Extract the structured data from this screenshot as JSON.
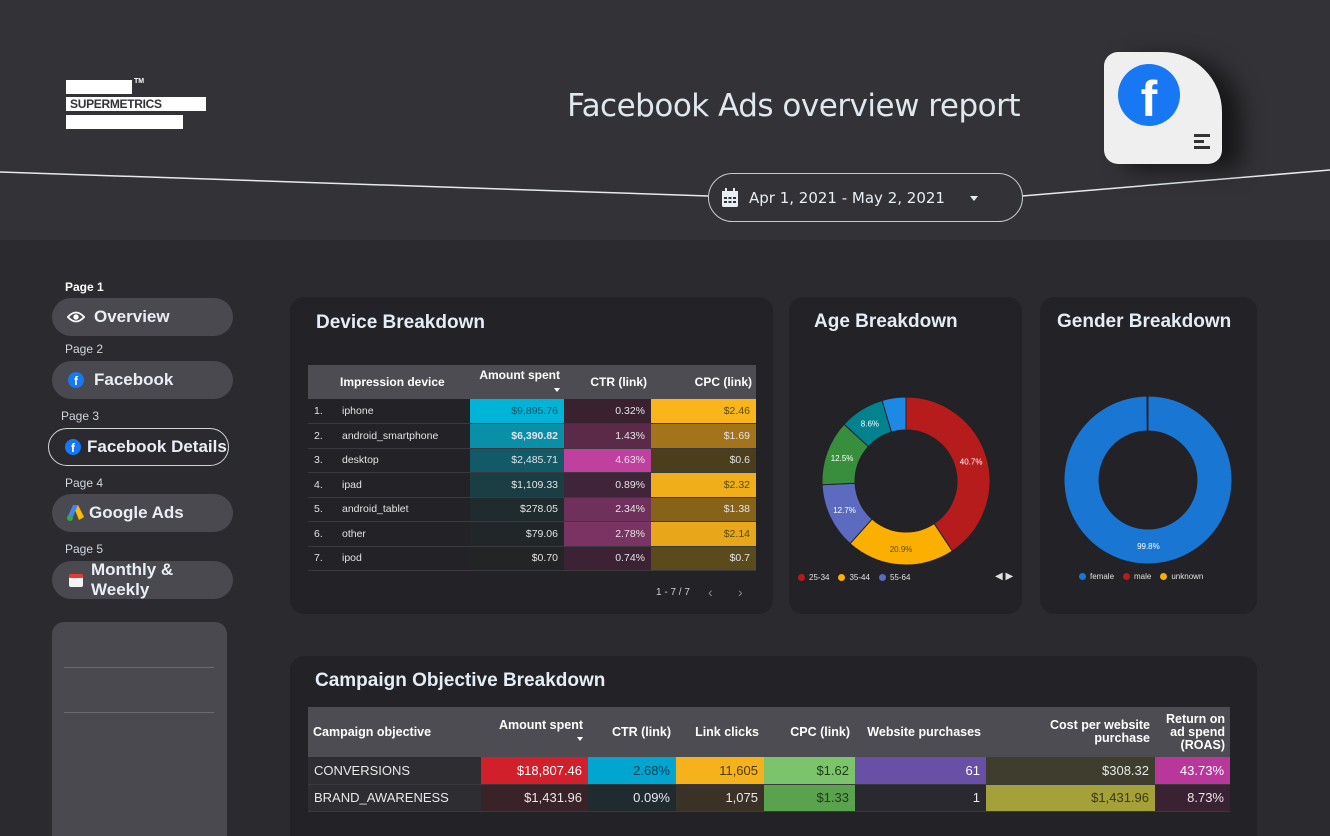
{
  "header": {
    "logo_text": "SUPERMETRICS",
    "logo_tm": "TM",
    "report_title": "Facebook Ads overview report",
    "badge_letter": "f",
    "date_range": "Apr 1, 2021 - May 2, 2021"
  },
  "nav": [
    {
      "page": "Page 1",
      "label": "Overview",
      "icon": "eye-icon"
    },
    {
      "page": "Page 2",
      "label": "Facebook",
      "icon": "facebook-icon"
    },
    {
      "page": "Page 3",
      "label": "Facebook Details",
      "icon": "facebook-icon"
    },
    {
      "page": "Page 4",
      "label": "Google Ads",
      "icon": "google-ads-icon"
    },
    {
      "page": "Page 5",
      "label": "Monthly & Weekly",
      "icon": "calendar-icon"
    }
  ],
  "device": {
    "title": "Device Breakdown",
    "columns": [
      "Impression device",
      "Amount spent",
      "CTR (link)",
      "CPC (link)"
    ],
    "rows": [
      {
        "idx": "1.",
        "device": "iphone",
        "spent": "$9,895.76",
        "ctr": "0.32%",
        "cpc": "$2.46"
      },
      {
        "idx": "2.",
        "device": "android_smartphone",
        "spent": "$6,390.82",
        "ctr": "1.43%",
        "cpc": "$1.69"
      },
      {
        "idx": "3.",
        "device": "desktop",
        "spent": "$2,485.71",
        "ctr": "4.63%",
        "cpc": "$0.6"
      },
      {
        "idx": "4.",
        "device": "ipad",
        "spent": "$1,109.33",
        "ctr": "0.89%",
        "cpc": "$2.32"
      },
      {
        "idx": "5.",
        "device": "android_tablet",
        "spent": "$278.05",
        "ctr": "2.34%",
        "cpc": "$1.38"
      },
      {
        "idx": "6.",
        "device": "other",
        "spent": "$79.06",
        "ctr": "2.78%",
        "cpc": "$2.14"
      },
      {
        "idx": "7.",
        "device": "ipod",
        "spent": "$0.70",
        "ctr": "0.74%",
        "cpc": "$0.7"
      }
    ],
    "pager": "1 - 7 / 7"
  },
  "age": {
    "title": "Age Breakdown",
    "legend_arrows": "◀ ▶"
  },
  "gender": {
    "title": "Gender Breakdown"
  },
  "campaign": {
    "title": "Campaign Objective Breakdown",
    "columns": [
      "Campaign objective",
      "Amount spent",
      "CTR (link)",
      "Link clicks",
      "CPC (link)",
      "Website purchases",
      "Cost per website purchase",
      "Return on ad spend (ROAS)"
    ],
    "rows": [
      {
        "objective": "CONVERSIONS",
        "spent": "$18,807.46",
        "ctr": "2.68%",
        "clicks": "11,605",
        "cpc": "$1.62",
        "purchases": "61",
        "cpp": "$308.32",
        "roas": "43.73%"
      },
      {
        "objective": "BRAND_AWARENESS",
        "spent": "$1,431.96",
        "ctr": "0.09%",
        "clicks": "1,075",
        "cpc": "$1.33",
        "purchases": "1",
        "cpp": "$1,431.96",
        "roas": "8.73%"
      }
    ]
  },
  "chart_data": [
    {
      "type": "pie",
      "title": "Age Breakdown",
      "categories": [
        "25-34",
        "35-44",
        "55-64",
        "",
        "",
        ""
      ],
      "values": [
        40.7,
        20.9,
        12.7,
        12.5,
        8.6,
        4.6
      ],
      "labels": [
        "40.7%",
        "20.9%",
        "12.7%",
        "12.5%",
        "8.6%",
        ""
      ],
      "colors": [
        "#b71c1c",
        "#fbb000",
        "#5c6bc0",
        "#388e3c",
        "#00838f",
        "#1e88e5"
      ],
      "legend": "bottom-left"
    },
    {
      "type": "pie",
      "title": "Gender Breakdown",
      "categories": [
        "female",
        "male",
        "unknown"
      ],
      "values": [
        99.8,
        0.15,
        0.05
      ],
      "labels": [
        "99.8%",
        "",
        ""
      ],
      "colors": [
        "#1976d2",
        "#b71c1c",
        "#fbb000"
      ],
      "legend": "bottom"
    }
  ],
  "colors": {
    "facebook_blue": "#1877f2",
    "card_bg": "#232226",
    "header_bg": "#4d4c52"
  }
}
